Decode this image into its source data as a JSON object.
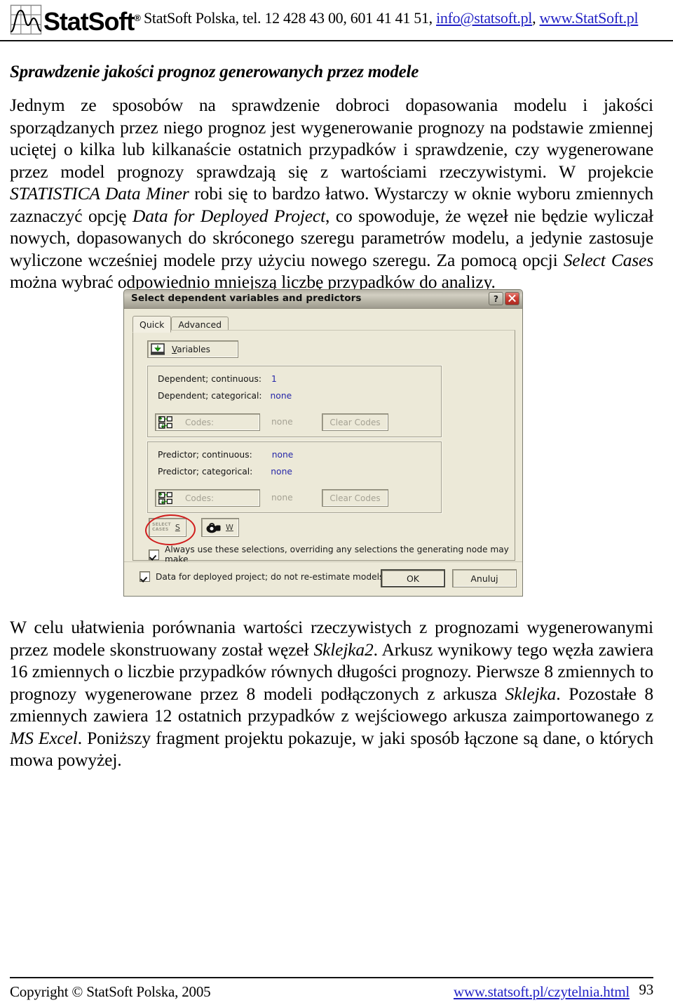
{
  "header": {
    "logo_word": "StatSoft",
    "logo_reg": "®",
    "contact_prefix": "StatSoft Polska, tel. 12 428 43 00, 601 41 41 51, ",
    "email": "info@statsoft.pl",
    "contact_sep": ", ",
    "website": "www.StatSoft.pl"
  },
  "article": {
    "title": "Sprawdzenie jakości prognoz generowanych przez modele",
    "paragraph1_part1": "Jednym ze sposobów na sprawdzenie dobroci dopasowania modelu i jakości sporządzanych przez niego prognoz jest wygenerowanie prognozy na podstawie zmiennej uciętej o kilka lub kilkanaście ostatnich przypadków i sprawdzenie, czy wygenerowane przez model prognozy sprawdzają się z wartościami rzeczywistymi. W projekcie ",
    "paragraph1_em1": "STATISTICA Data Miner",
    "paragraph1_part2": " robi się to bardzo łatwo. Wystarczy w oknie wyboru zmiennych zaznaczyć opcję ",
    "paragraph1_em2": "Data for Deployed Project",
    "paragraph1_part3": ", co spowoduje, że węzeł nie będzie wyliczał nowych, dopasowanych do skróconego szeregu parametrów modelu, a jedynie zastosuje wyliczone wcześniej modele przy użyciu nowego szeregu. Za pomocą opcji ",
    "paragraph1_em3": "Select Cases",
    "paragraph1_part4": " można wybrać odpowiednio mniejszą liczbę przypadków do analizy.",
    "paragraph2_part1": "W celu ułatwienia porównania wartości rzeczywistych z prognozami wygenerowanymi przez modele skonstruowany został węzeł ",
    "paragraph2_em1": "Sklejka2",
    "paragraph2_part2": ". Arkusz wynikowy tego węzła zawiera 16 zmiennych o liczbie przypadków równych długości prognozy. Pierwsze 8 zmiennych to prognozy wygenerowane przez 8 modeli podłączonych z arkusza ",
    "paragraph2_em2": "Sklejka",
    "paragraph2_part3": ". Pozostałe 8 zmiennych zawiera 12 ostatnich przypadków z wejściowego arkusza zaimportowanego z ",
    "paragraph2_em3": "MS Excel",
    "paragraph2_part4": ". Poniższy fragment projektu pokazuje, w jaki sposób łączone są dane, o których mowa powyżej."
  },
  "dialog": {
    "title": "Select dependent variables and predictors",
    "help_button": "?",
    "close_button": "✕",
    "tabs": [
      {
        "label": "Quick",
        "active": true
      },
      {
        "label": "Advanced",
        "active": false
      }
    ],
    "variables_button": {
      "label_prefix": "",
      "accel": "V",
      "label_rest": "ariables"
    },
    "dependent_group": {
      "rows": [
        {
          "label": "Dependent; continuous:",
          "value": "1"
        },
        {
          "label": "Dependent; categorical:",
          "value": "none"
        }
      ],
      "codes_button": {
        "accel_pre": "C",
        "accel": "o",
        "rest": "des:"
      },
      "codes_button_label": "Codes:",
      "codes_value": "none",
      "clear_codes_label": "Clear Codes"
    },
    "predictor_group": {
      "rows": [
        {
          "label": "Predictor; continuous:",
          "value": "none"
        },
        {
          "label": "Predictor; categorical:",
          "value": "none"
        }
      ],
      "codes_button_label": "Codes:",
      "codes_value": "none",
      "clear_codes_label": "Clear Codes"
    },
    "select_cases_button": {
      "line1": "SELECT",
      "line2": "CASES",
      "accel": "S"
    },
    "weight_button": {
      "accel": "W"
    },
    "always_use_checkbox": {
      "checked": true,
      "label": "Always use these selections, overriding any selections the generating node may make"
    },
    "deployed_checkbox": {
      "checked": true,
      "label": "Data for deployed project; do not re-estimate models"
    },
    "ok_button": "OK",
    "cancel_button": "Anuluj"
  },
  "footer": {
    "copyright": "Copyright © StatSoft Polska, 2005",
    "link": "www.statsoft.pl/czytelnia.html",
    "page_number": "93"
  },
  "colors": {
    "link": "#1f1fc4",
    "annotation": "#d01d1d",
    "dialog_face": "#ece9d8",
    "field_value": "#2526a8"
  }
}
